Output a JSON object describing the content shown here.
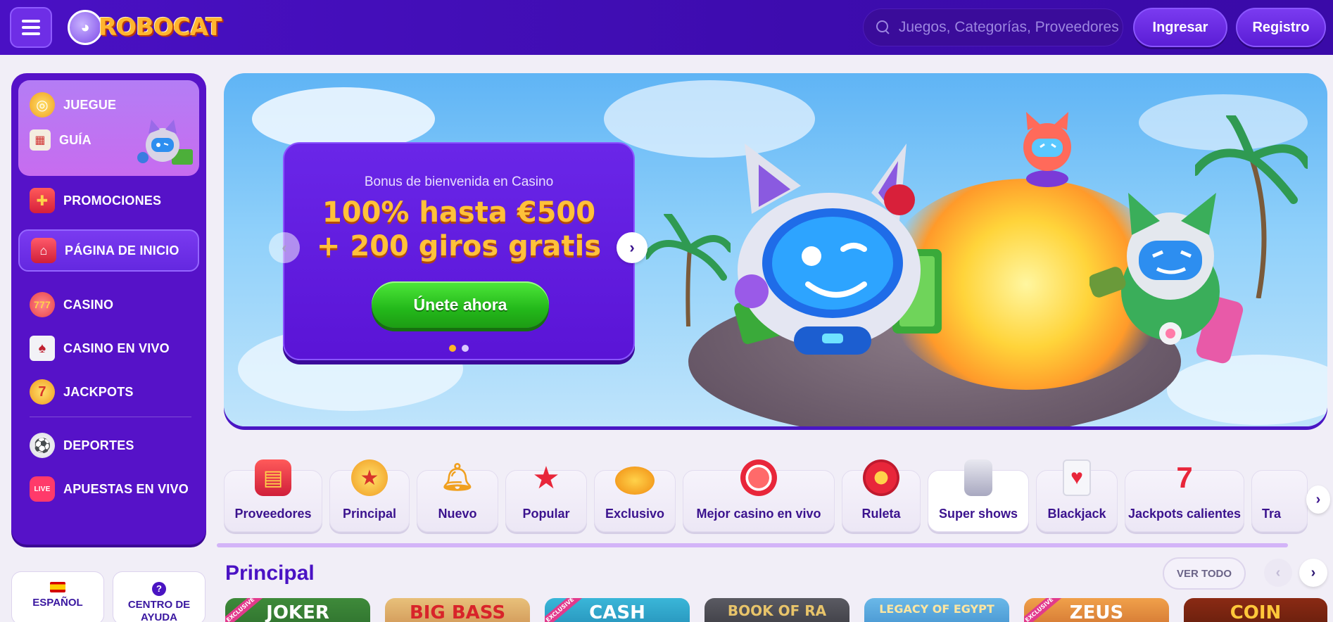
{
  "header": {
    "logo_text": "ROBOCAT",
    "search_placeholder": "Juegos, Categorías, Proveedores",
    "login_label": "Ingresar",
    "register_label": "Registro"
  },
  "sidebar": {
    "items": [
      {
        "label": "JUEGUE",
        "icon": "coin-icon"
      },
      {
        "label": "GUÍA",
        "icon": "map-icon"
      },
      {
        "label": "PROMOCIONES",
        "icon": "gift-icon"
      },
      {
        "label": "PÁGINA DE INICIO",
        "icon": "house-icon"
      },
      {
        "label": "CASINO",
        "icon": "slot-icon"
      },
      {
        "label": "CASINO EN VIVO",
        "icon": "cards-icon"
      },
      {
        "label": "JACKPOTS",
        "icon": "seven-icon"
      },
      {
        "label": "DEPORTES",
        "icon": "soccer-ball-icon"
      },
      {
        "label": "APUESTAS EN VIVO",
        "icon": "live-icon"
      }
    ],
    "language_label": "ESPAÑOL",
    "help_label": "CENTRO DE AYUDA"
  },
  "banner": {
    "subtitle": "Bonus de bienvenida en Casino",
    "title_line1": "100% hasta €500",
    "title_line2": "+ 200 giros gratis",
    "cta_label": "Únete ahora",
    "slide_count": 2,
    "active_slide": 1
  },
  "categories": [
    {
      "label": "Proveedores",
      "icon": "book-icon"
    },
    {
      "label": "Principal",
      "icon": "medal-icon"
    },
    {
      "label": "Nuevo",
      "icon": "bell-icon"
    },
    {
      "label": "Popular",
      "icon": "star-icon"
    },
    {
      "label": "Exclusivo",
      "icon": "gem-icon"
    },
    {
      "label": "Mejor casino en vivo",
      "icon": "chip-icon"
    },
    {
      "label": "Ruleta",
      "icon": "roulette-icon"
    },
    {
      "label": "Super shows",
      "icon": "coin-stack-icon"
    },
    {
      "label": "Blackjack",
      "icon": "playing-cards-icon"
    },
    {
      "label": "Jackpots calientes",
      "icon": "fire-seven-icon"
    },
    {
      "label": "Tra",
      "icon": "slot-icon"
    }
  ],
  "section": {
    "title": "Principal",
    "see_all_label": "VER TODO"
  },
  "games": [
    {
      "title": "JOKER",
      "exclusive": "EXCLUSIVE",
      "color": "#3e8a3a"
    },
    {
      "title": "BIG BASS",
      "exclusive": "",
      "color": "#d9a15a"
    },
    {
      "title": "CASH",
      "exclusive": "EXCLUSIVE",
      "color": "#2fa6c9"
    },
    {
      "title": "BOOK OF RA",
      "exclusive": "",
      "color": "#4a4a52"
    },
    {
      "title": "LEGACY OF EGYPT",
      "exclusive": "",
      "color": "#4fa4d8"
    },
    {
      "title": "ZEUS",
      "exclusive": "EXCLUSIVE",
      "color": "#d8823a"
    },
    {
      "title": "COIN",
      "exclusive": "",
      "color": "#7a2a14"
    }
  ],
  "colors": {
    "header_bg": "#4a10c4",
    "sidebar_bg": "#5612c8",
    "accent_gold": "#ffc13a",
    "cta_green": "#23b81a"
  }
}
